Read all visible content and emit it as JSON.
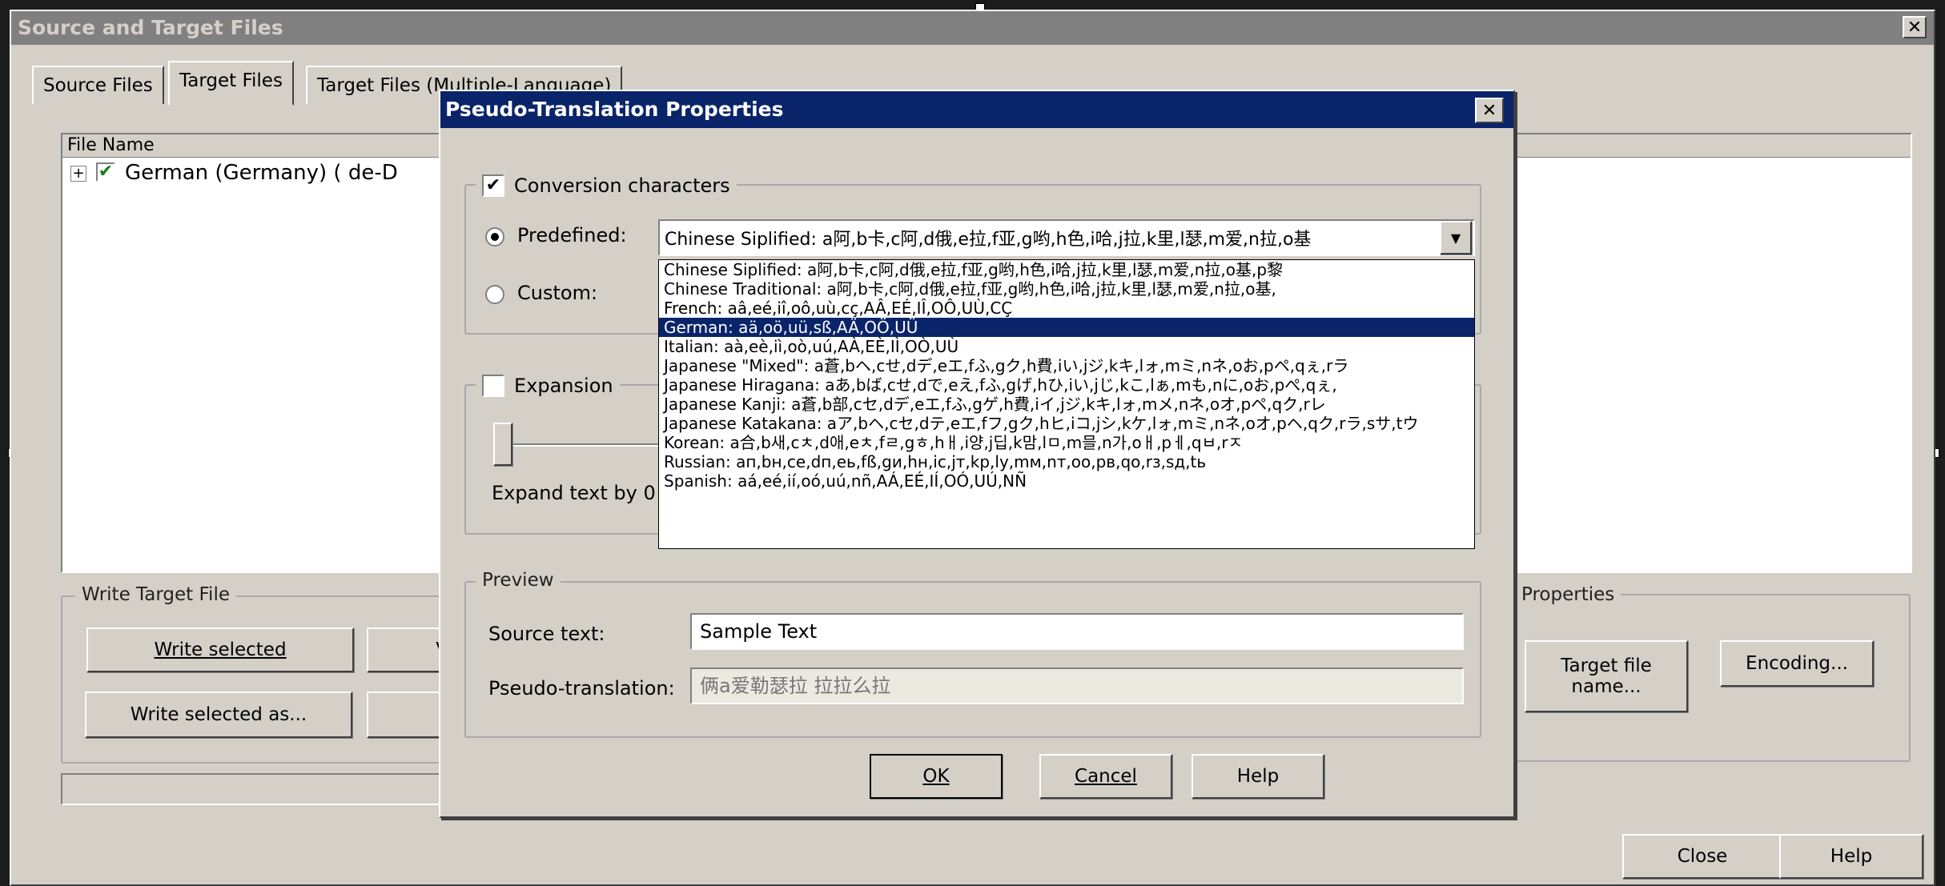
{
  "main": {
    "title": "Source and Target Files",
    "tabs": [
      "Source Files",
      "Target Files",
      "Target Files (Multiple-Language)"
    ],
    "file_list": {
      "header": "File Name",
      "rows": [
        {
          "expander": "+",
          "checked": true,
          "label": "German (Germany) ( de-D"
        }
      ]
    },
    "write_group": {
      "label": "Write Target File",
      "write_selected": "Write selected",
      "write_selected_as": "Write selected as...",
      "partial_button": "V"
    },
    "properties_group": {
      "label": "Properties",
      "target_file_name": "Target file name...",
      "encoding": "Encoding..."
    },
    "close_button": "Close",
    "help_button": "Help"
  },
  "dialog": {
    "title": "Pseudo-Translation Properties",
    "conversion_label": "Conversion characters",
    "conversion_checked": true,
    "predefined_label": "Predefined:",
    "custom_label": "Custom:",
    "predefined_selected": true,
    "predefined_value": "Chinese Siplified: a阿,b卡,c阿,d俄,e拉,f亚,g哟,h色,i哈,j拉,k里,l瑟,m爱,n拉,o基",
    "dropdown_options": [
      "Chinese Siplified: a阿,b卡,c阿,d俄,e拉,f亚,g哟,h色,i哈,j拉,k里,l瑟,m爱,n拉,o基,p黎",
      "Chinese Traditional: a阿,b卡,c阿,d俄,e拉,f亚,g哟,h色,i哈,j拉,k里,l瑟,m爱,n拉,o基,",
      "French: aâ,eé,iî,oô,uù,cç,AÂ,EÉ,IÎ,OÔ,UÙ,CÇ",
      "German: aä,oö,uü,sß,AÄ,OÖ,UÜ",
      "Italian: aà,eè,iì,oò,uú,AÀ,EÈ,IÌ,OÒ,UÙ",
      "Japanese \"Mixed\": a蒼,bヘ,cせ,dデ,eエ,fふ,gク,h費,iい,jジ,kキ,lォ,mミ,nネ,oお,pペ,qぇ,rラ",
      "Japanese Hiragana: aあ,bば,cせ,dで,eえ,fふ,gげ,hひ,iい,jじ,kこ,lぁ,mも,nに,oお,pぺ,qぇ,",
      "Japanese Kanji: a蒼,b部,cセ,dデ,eエ,fふ,gゲ,h費,iイ,jジ,kキ,lォ,mメ,nネ,oオ,pペ,qク,rレ",
      "Japanese Katakana: aア,bヘ,cセ,dテ,eエ,fフ,gク,hヒ,iコ,jシ,kケ,lォ,mミ,nネ,oオ,pヘ,qク,rラ,sサ,tウ",
      "Korean: a合,b새,cㅊ,d애,eㅊ,fㄹ,gㅎ,hㅐ,i양,j딥,k맘,lㅁ,m믈,n가,oㅐ,pㅔ,qㅂ,rㅈ",
      "Russian: aп,bн,ce,dп,eь,fß,gи,hн,ic,jт,kp,ly,mм,nт,oo,pв,qo,rз,sд,tь",
      "Spanish: aá,eé,ií,oó,uú,nñ,AÁ,EÉ,IÍ,OÓ,UÚ,NÑ"
    ],
    "selected_option_index": 3,
    "expansion_label": "Expansion",
    "expansion_checked": false,
    "expand_text": "Expand text by 0",
    "preview_label": "Preview",
    "source_text_label": "Source text:",
    "source_text_value": "Sample Text",
    "pseudo_label": "Pseudo-translation:",
    "pseudo_value": "俩a爱勒瑟拉 拉拉么拉",
    "ok": "OK",
    "cancel": "Cancel",
    "help": "Help",
    "close_glyph": "✕"
  }
}
